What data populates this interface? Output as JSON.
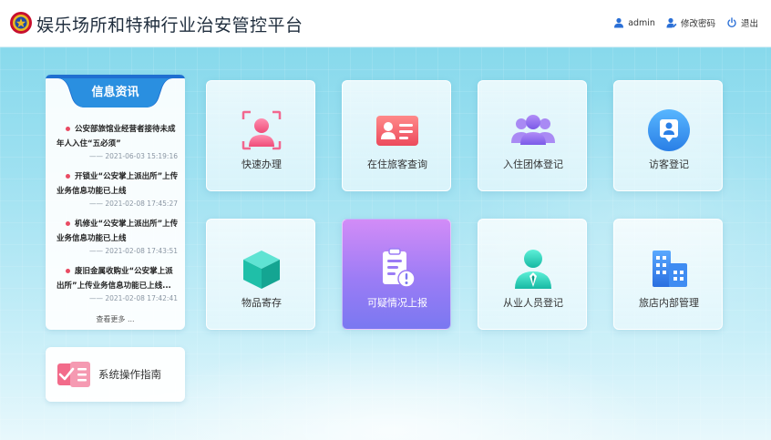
{
  "header": {
    "title": "娱乐场所和特种行业治安管控平台",
    "user": "admin",
    "change_password": "修改密码",
    "logout": "退出"
  },
  "news": {
    "title": "信息资讯",
    "items": [
      {
        "text": "公安部旅馆业经营者接待未成年人入住“五必须”",
        "date": "—— 2021-06-03 15:19:16"
      },
      {
        "text": "开锁业“公安掌上派出所”上传业务信息功能已上线",
        "date": "—— 2021-02-08 17:45:27"
      },
      {
        "text": "机修业“公安掌上派出所”上传业务信息功能已上线",
        "date": "—— 2021-02-08 17:43:51"
      },
      {
        "text": "废旧金属收购业“公安掌上派出所”上传业务信息功能已上线...",
        "date": "—— 2021-02-08 17:42:41"
      }
    ],
    "more": "查看更多 ..."
  },
  "guide": {
    "label": "系统操作指南"
  },
  "tiles": [
    {
      "label": "快速办理",
      "icon": "face-scan-icon"
    },
    {
      "label": "在住旅客查询",
      "icon": "id-card-icon"
    },
    {
      "label": "入住团体登记",
      "icon": "group-icon"
    },
    {
      "label": "访客登记",
      "icon": "visitor-icon"
    },
    {
      "label": "物品寄存",
      "icon": "box-icon"
    },
    {
      "label": "可疑情况上报",
      "icon": "report-alert-icon"
    },
    {
      "label": "从业人员登记",
      "icon": "staff-icon"
    },
    {
      "label": "旅店内部管理",
      "icon": "building-icon"
    }
  ],
  "colors": {
    "accent_blue": "#2a8fe0",
    "dot_red": "#e94b63",
    "active_tile_top": "#d28cf7",
    "active_tile_bottom": "#7a78f1"
  }
}
